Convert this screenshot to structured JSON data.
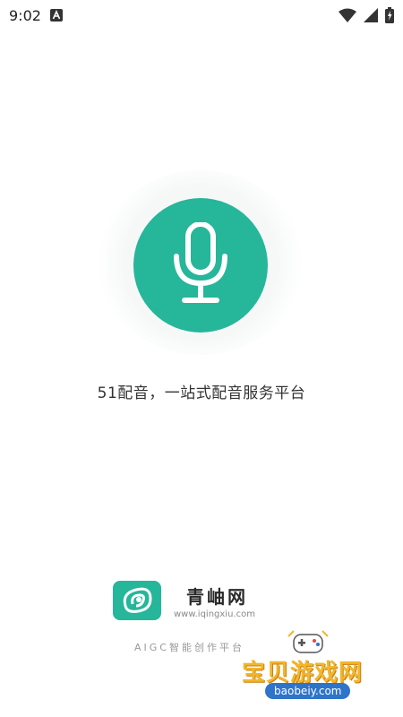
{
  "status_bar": {
    "time": "9:02",
    "icons": [
      "a11y-icon",
      "wifi-icon",
      "signal-icon",
      "battery-charging-icon"
    ]
  },
  "hero": {
    "tagline": "51配音，一站式配音服务平台",
    "icon": "microphone-icon",
    "accent_color": "#26b69a"
  },
  "brand": {
    "name": "青岫网",
    "url": "www.iqingxiu.com",
    "slogan": "AIGC智能创作平台",
    "logo_icon": "qingxiu-logo-icon"
  },
  "watermark": {
    "text": "宝贝游戏网",
    "url": "baobeiy.com",
    "icon": "gamepad-icon"
  }
}
